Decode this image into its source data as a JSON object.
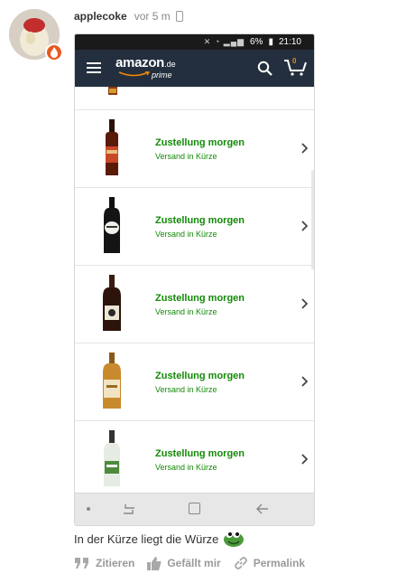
{
  "post": {
    "username": "applecoke",
    "time": "vor 5 m",
    "caption": "In der Kürze liegt die Würze"
  },
  "phone_status": {
    "battery": "6%",
    "time": "21:10"
  },
  "amazon": {
    "logo_word": "amazon",
    "logo_tld": ".de",
    "logo_sub": "prime",
    "cart_count": "0"
  },
  "items": [
    {
      "title": "Zustellung morgen",
      "subtitle": "Versand in Kürze",
      "product": "rum-bottle"
    },
    {
      "title": "Zustellung morgen",
      "subtitle": "Versand in Kürze",
      "product": "gin-bottle"
    },
    {
      "title": "Zustellung morgen",
      "subtitle": "Versand in Kürze",
      "product": "spiced-rum-bottle"
    },
    {
      "title": "Zustellung morgen",
      "subtitle": "Versand in Kürze",
      "product": "whisky-bottle"
    },
    {
      "title": "Zustellung morgen",
      "subtitle": "Versand in Kürze",
      "product": "clear-spirit-bottle"
    }
  ],
  "actions": {
    "quote": "Zitieren",
    "like": "Gefällt mir",
    "permalink": "Permalink"
  },
  "colors": {
    "amazon_header": "#232f3e",
    "delivery_green": "#138a07",
    "badge": "#e85a1e"
  }
}
